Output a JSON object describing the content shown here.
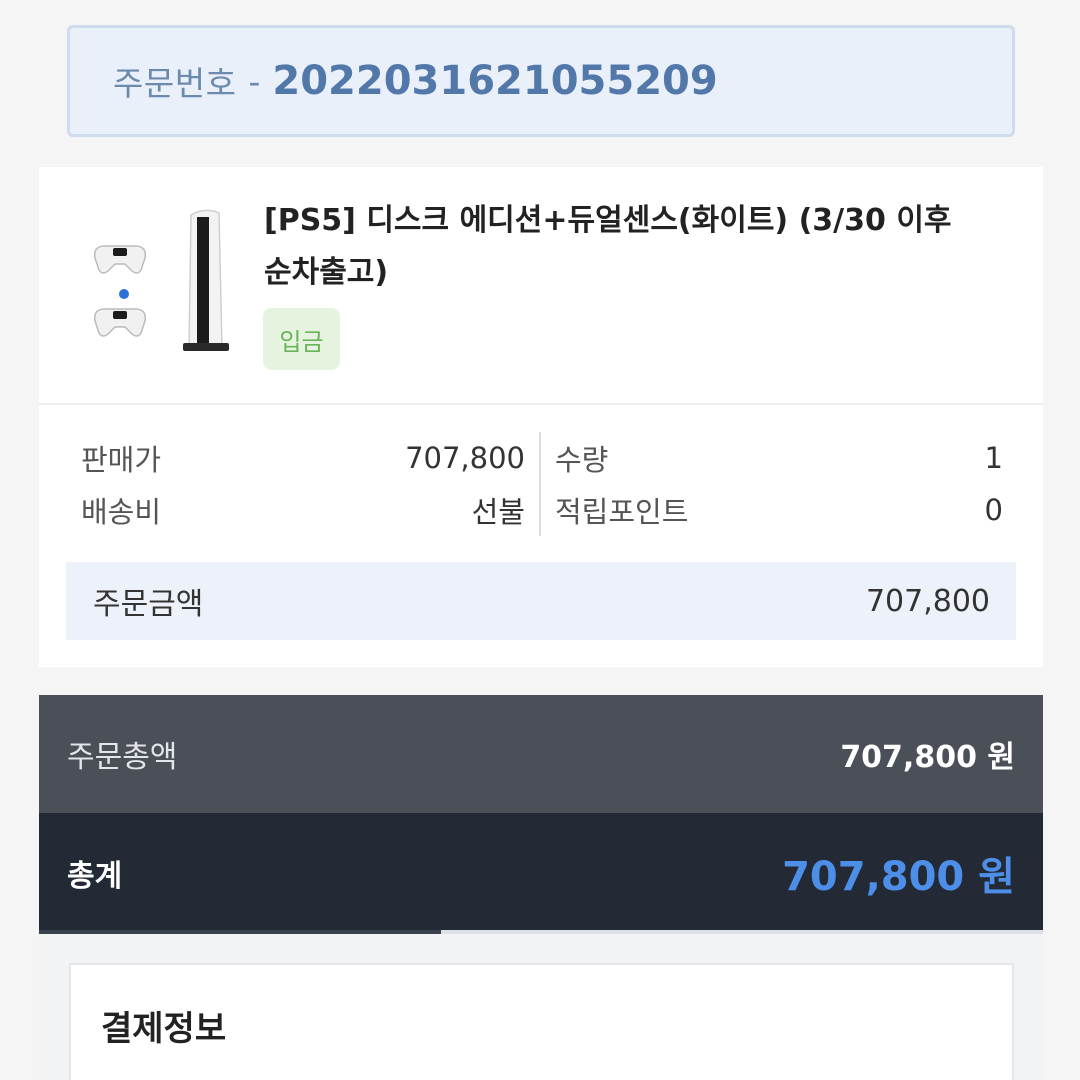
{
  "order": {
    "label": "주문번호",
    "separator": "-",
    "number": "2022031621055209"
  },
  "product": {
    "title_line1": "[PS5] 디스크 에디션+듀얼센스(화이트) (3/30 이후",
    "title_line2": "순차출고)",
    "status_badge": "입금",
    "image_icon": "ps5-console-with-controllers-image"
  },
  "details": {
    "sale_price_label": "판매가",
    "sale_price_value": "707,800",
    "quantity_label": "수량",
    "quantity_value": "1",
    "shipping_label": "배송비",
    "shipping_value": "선불",
    "points_label": "적립포인트",
    "points_value": "0"
  },
  "order_amount": {
    "label": "주문금액",
    "value": "707,800"
  },
  "totals": {
    "order_total_label": "주문총액",
    "order_total_value": "707,800 원",
    "grand_total_label": "총계",
    "grand_total_value": "707,800 원",
    "scroll_progress_fraction": 0.4
  },
  "payment": {
    "section_title": "결제정보"
  },
  "colors": {
    "accent_blue": "#4d8fe8",
    "badge_green": "#6bb35a",
    "dark_bar": "#232a35",
    "mid_bar": "#4a4f58"
  }
}
